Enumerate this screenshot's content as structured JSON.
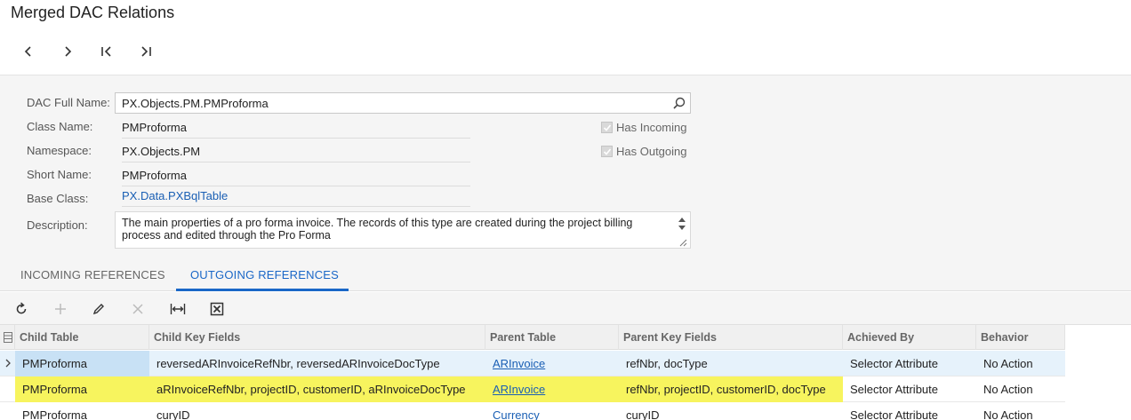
{
  "page": {
    "title": "Merged DAC Relations"
  },
  "nav": [
    {
      "name": "prev-record-button",
      "icon": "chevron-left-icon"
    },
    {
      "name": "next-record-button",
      "icon": "chevron-right-icon"
    },
    {
      "name": "first-record-button",
      "icon": "first-record-icon"
    },
    {
      "name": "last-record-button",
      "icon": "last-record-icon"
    }
  ],
  "form": {
    "dac_full_name_label": "DAC Full Name:",
    "dac_full_name_value": "PX.Objects.PM.PMProforma",
    "class_name_label": "Class Name:",
    "class_name_value": "PMProforma",
    "namespace_label": "Namespace:",
    "namespace_value": "PX.Objects.PM",
    "short_name_label": "Short Name:",
    "short_name_value": "PMProforma",
    "base_class_label": "Base Class:",
    "base_class_value": "PX.Data.PXBqlTable",
    "description_label": "Description:",
    "description_value": "The main properties of a pro forma invoice. The records of this type are created during the project billing process and edited through the Pro Forma",
    "has_incoming_label": "Has Incoming",
    "has_outgoing_label": "Has Outgoing",
    "has_incoming_checked": true,
    "has_outgoing_checked": true
  },
  "tabs": [
    {
      "label": "INCOMING REFERENCES",
      "active": false
    },
    {
      "label": "OUTGOING REFERENCES",
      "active": true
    }
  ],
  "toolbar": [
    "refresh-icon",
    "add-icon",
    "edit-icon",
    "delete-icon",
    "fit-columns-icon",
    "export-excel-icon"
  ],
  "grid": {
    "columns": [
      "Child Table",
      "Child Key Fields",
      "Parent Table",
      "Parent Key Fields",
      "Achieved By",
      "Behavior"
    ],
    "rows": [
      [
        "PMProforma",
        "reversedARInvoiceRefNbr, reversedARInvoiceDocType",
        "ARInvoice",
        "refNbr, docType",
        "Selector Attribute",
        "No Action"
      ],
      [
        "PMProforma",
        "aRInvoiceRefNbr, projectID, customerID, aRInvoiceDocType",
        "ARInvoice",
        "refNbr, projectID, customerID, docType",
        "Selector Attribute",
        "No Action"
      ],
      [
        "PMProforma",
        "curyID",
        "Currency",
        "curyID",
        "Selector Attribute",
        "No Action"
      ]
    ]
  },
  "colors": {
    "accent": "#1a67c7",
    "highlight": "#f7f45e",
    "selected_row": "#e6f2fb"
  }
}
